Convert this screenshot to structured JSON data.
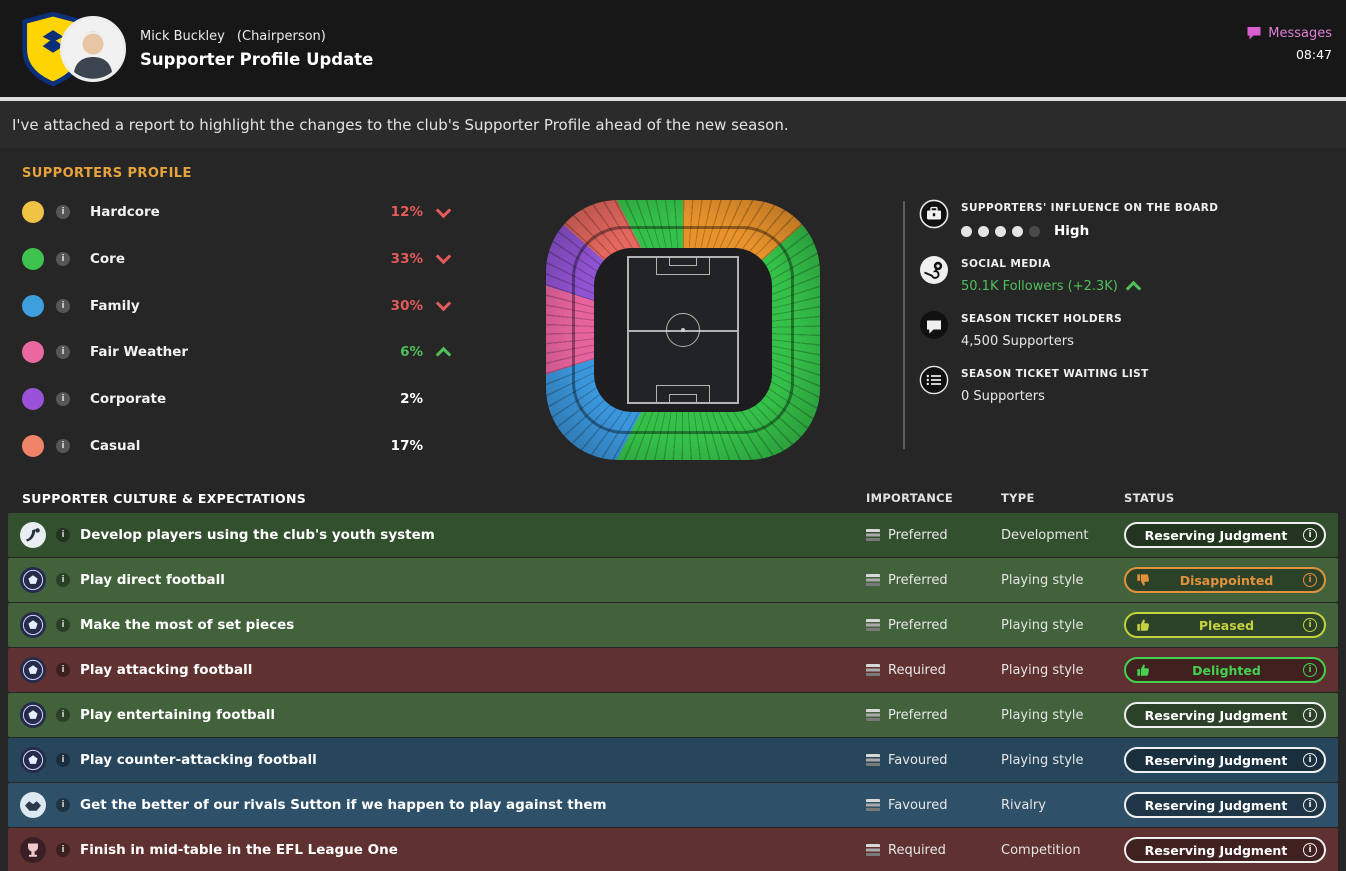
{
  "header": {
    "sender_name": "Mick Buckley",
    "sender_role": "(Chairperson)",
    "subject": "Supporter Profile Update",
    "messages_label": "Messages",
    "time": "08:47"
  },
  "message_body": "I've attached a report to highlight the changes to the club's Supporter Profile ahead of the new season.",
  "supporters_profile": {
    "title": "SUPPORTERS PROFILE",
    "segments": [
      {
        "label": "Hardcore",
        "value": "12%",
        "trend": "down",
        "color": "#f0c344",
        "value_color": "#e25b5b"
      },
      {
        "label": "Core",
        "value": "33%",
        "trend": "down",
        "color": "#3ec44e",
        "value_color": "#e25b5b"
      },
      {
        "label": "Family",
        "value": "30%",
        "trend": "down",
        "color": "#3e9fdf",
        "value_color": "#e25b5b"
      },
      {
        "label": "Fair Weather",
        "value": "6%",
        "trend": "up",
        "color": "#ea67a0",
        "value_color": "#4fc05a"
      },
      {
        "label": "Corporate",
        "value": "2%",
        "trend": "none",
        "color": "#9a52d8",
        "value_color": "#ffffff"
      },
      {
        "label": "Casual",
        "value": "17%",
        "trend": "none",
        "color": "#ef8468",
        "value_color": "#ffffff"
      }
    ],
    "stats": {
      "board_influence": {
        "label": "SUPPORTERS' INFLUENCE ON THE BOARD",
        "value": "High",
        "dots_filled": 4,
        "dots_total": 5
      },
      "social_media": {
        "label": "SOCIAL MEDIA",
        "value": "50.1K Followers (+2.3K)",
        "trend": "up"
      },
      "season_ticket_holders": {
        "label": "SEASON TICKET HOLDERS",
        "value": "4,500 Supporters"
      },
      "season_ticket_waiting_list": {
        "label": "SEASON TICKET WAITING LIST",
        "value": "0 Supporters"
      }
    }
  },
  "culture": {
    "title": "SUPPORTER CULTURE & EXPECTATIONS",
    "columns": {
      "importance": "IMPORTANCE",
      "type": "TYPE",
      "status": "STATUS"
    },
    "rows": [
      {
        "icon": "youth-icon",
        "text": "Develop players using the club's youth system",
        "importance": "Preferred",
        "type": "Development",
        "status": "Reserving Judgment",
        "status_kind": "neutral",
        "tone": "green-dark"
      },
      {
        "icon": "football-icon",
        "text": "Play direct football",
        "importance": "Preferred",
        "type": "Playing style",
        "status": "Disappointed",
        "status_kind": "disappointed",
        "tone": "green"
      },
      {
        "icon": "football-icon",
        "text": "Make the most of set pieces",
        "importance": "Preferred",
        "type": "Playing style",
        "status": "Pleased",
        "status_kind": "pleased",
        "tone": "green"
      },
      {
        "icon": "football-icon",
        "text": "Play attacking football",
        "importance": "Required",
        "type": "Playing style",
        "status": "Delighted",
        "status_kind": "delighted",
        "tone": "red"
      },
      {
        "icon": "football-icon",
        "text": "Play entertaining football",
        "importance": "Preferred",
        "type": "Playing style",
        "status": "Reserving Judgment",
        "status_kind": "neutral",
        "tone": "green"
      },
      {
        "icon": "football-icon",
        "text": "Play counter-attacking football",
        "importance": "Favoured",
        "type": "Playing style",
        "status": "Reserving Judgment",
        "status_kind": "neutral",
        "tone": "blue-dark"
      },
      {
        "icon": "rivalry-icon",
        "text": "Get the better of our rivals Sutton if we happen to play against them",
        "importance": "Favoured",
        "type": "Rivalry",
        "status": "Reserving Judgment",
        "status_kind": "neutral",
        "tone": "blue"
      },
      {
        "icon": "trophy-icon",
        "text": "Finish in mid-table in the EFL League One",
        "importance": "Required",
        "type": "Competition",
        "status": "Reserving Judgment",
        "status_kind": "neutral",
        "tone": "red"
      }
    ]
  },
  "colors": {
    "heading_accent": "#e8a33d",
    "messages_pink": "#e27fd8",
    "trend_up": "#4fc05a",
    "trend_down": "#e25b5b",
    "status_neutral": "#f0f0f0",
    "status_disappointed": "#e2923c",
    "status_pleased": "#c3d23e",
    "status_delighted": "#43d14e"
  }
}
